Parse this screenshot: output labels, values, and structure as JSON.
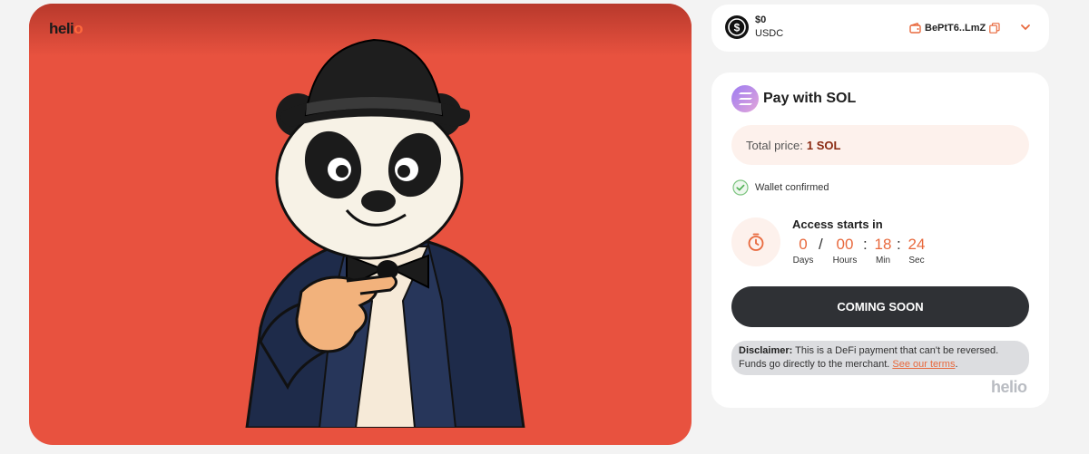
{
  "hero": {
    "logo_text": "heli",
    "logo_dot": "o",
    "background_color": "#e8523f",
    "image": "panda-in-fedora-pointing"
  },
  "wallet": {
    "balance_amount": "$0",
    "balance_currency": "USDC",
    "address": "BePtT6..LmZ",
    "wallet_icon": "wallet-icon",
    "copy_icon": "copy-icon",
    "menu_icon": "chevron-down-icon"
  },
  "payment": {
    "method_title": "Pay with SOL",
    "total_label": "Total price:",
    "total_value": "1 SOL",
    "wallet_status": "Wallet confirmed",
    "access_title": "Access starts in",
    "countdown": {
      "days": "0",
      "days_label": "Days",
      "hours": "00",
      "hours_label": "Hours",
      "minutes": "18",
      "minutes_label": "Min",
      "seconds": "24",
      "seconds_label": "Sec",
      "sep_slash": "/",
      "sep_colon": ":"
    },
    "cta_label": "COMING SOON",
    "disclaimer_label": "Disclaimer:",
    "disclaimer_text": "This is a DeFi payment that can't be reversed. Funds go directly to the merchant.",
    "disclaimer_link": "See our terms",
    "disclaimer_end": ".",
    "footer_brand": "helio"
  },
  "colors": {
    "accent": "#e8693d",
    "cta_bg": "#2f3135",
    "success": "#4caf50"
  }
}
